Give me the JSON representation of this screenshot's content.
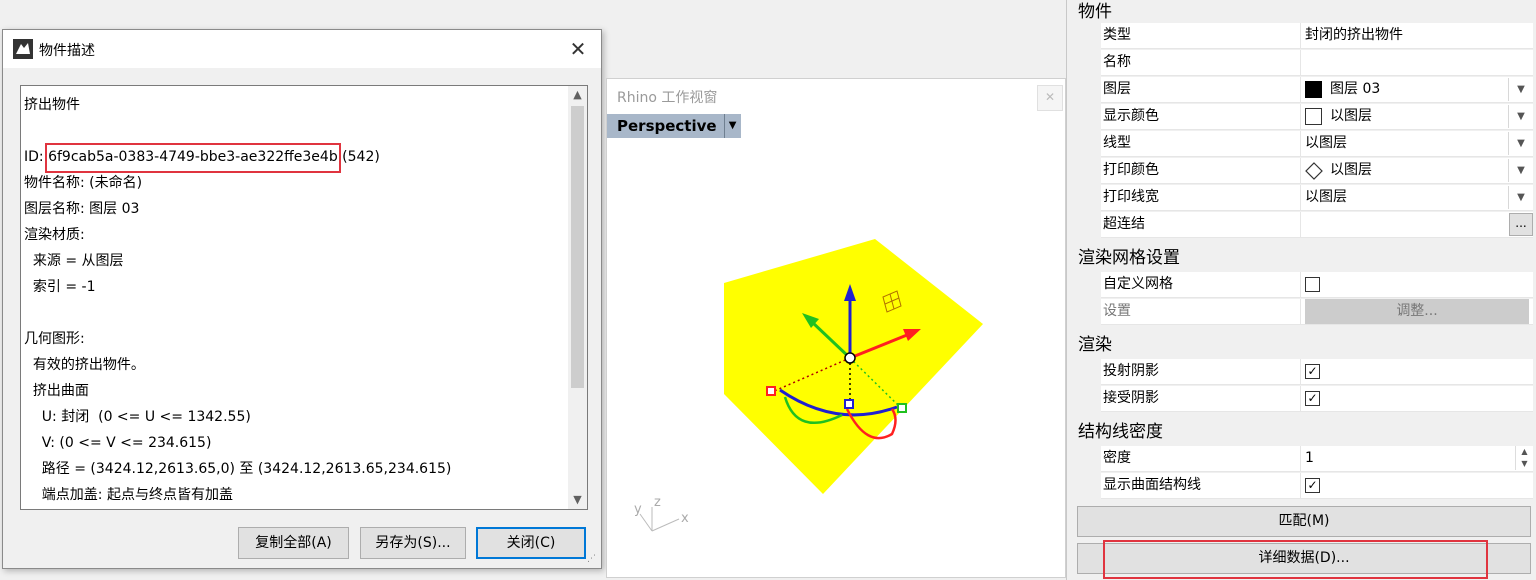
{
  "dialog": {
    "title": "物件描述",
    "lines": {
      "l0": "挤出物件",
      "l1": "",
      "id_prefix": "ID: ",
      "id_value": "6f9cab5a-0383-4749-bbe3-ae322ffe3e4b",
      "id_suffix": " (542)",
      "l3": "物件名称: (未命名)",
      "l4": "图层名称: 图层 03",
      "l5": "渲染材质:",
      "l6": "  来源 = 从图层",
      "l7": "  索引 = -1",
      "l8": "",
      "l9": "几何图形:",
      "l10": "  有效的挤出物件。",
      "l11": "  挤出曲面",
      "l12": "    U: 封闭  (0 <= U <= 1342.55)",
      "l13": "    V: (0 <= V <= 234.615)",
      "l14": "    路径 = (3424.12,2613.65,0) 至 (3424.12,2613.65,234.615)",
      "l15": "    端点加盖: 起点与终点皆有加盖"
    },
    "buttons": {
      "copy_all": "复制全部(A)",
      "save_as": "另存为(S)...",
      "close": "关闭(C)"
    }
  },
  "viewport": {
    "window_title": "Rhino 工作视窗",
    "view_name": "Perspective",
    "axis_x": "x",
    "axis_y": "y",
    "axis_z": "z"
  },
  "panel": {
    "sections": {
      "object": "物件",
      "render_mesh": "渲染网格设置",
      "render": "渲染",
      "isocurve": "结构线密度"
    },
    "rows": {
      "type_label": "类型",
      "type_value": "封闭的挤出物件",
      "name_label": "名称",
      "name_value": "",
      "layer_label": "图层",
      "layer_value": "图层 03",
      "display_color_label": "显示颜色",
      "display_color_value": "以图层",
      "linetype_label": "线型",
      "linetype_value": "以图层",
      "print_color_label": "打印颜色",
      "print_color_value": "以图层",
      "print_width_label": "打印线宽",
      "print_width_value": "以图层",
      "hyperlink_label": "超连结",
      "hyperlink_button": "...",
      "custom_mesh_label": "自定义网格",
      "settings_label": "设置",
      "adjust_button": "调整...",
      "cast_shadow_label": "投射阴影",
      "receive_shadow_label": "接受阴影",
      "density_label": "密度",
      "density_value": "1",
      "show_iso_label": "显示曲面结构线"
    },
    "checks": {
      "custom_mesh": false,
      "cast_shadow": true,
      "receive_shadow": true,
      "show_iso": true
    },
    "buttons": {
      "match": "匹配(M)",
      "details": "详细数据(D)..."
    }
  },
  "colors": {
    "highlight_red": "#e0343f",
    "object_yellow": "#ffff00",
    "gumball_x": "#ff2020",
    "gumball_y": "#20c020",
    "gumball_z": "#2020d0",
    "layer_swatch": "#000000",
    "view_tab": "#a8b7c9"
  },
  "icons": {
    "dialog_icon": "rhino-icon",
    "close": "close-icon",
    "scroll_up": "chevron-up-icon",
    "scroll_down": "chevron-down-icon",
    "dropdown": "chevron-down-icon"
  }
}
